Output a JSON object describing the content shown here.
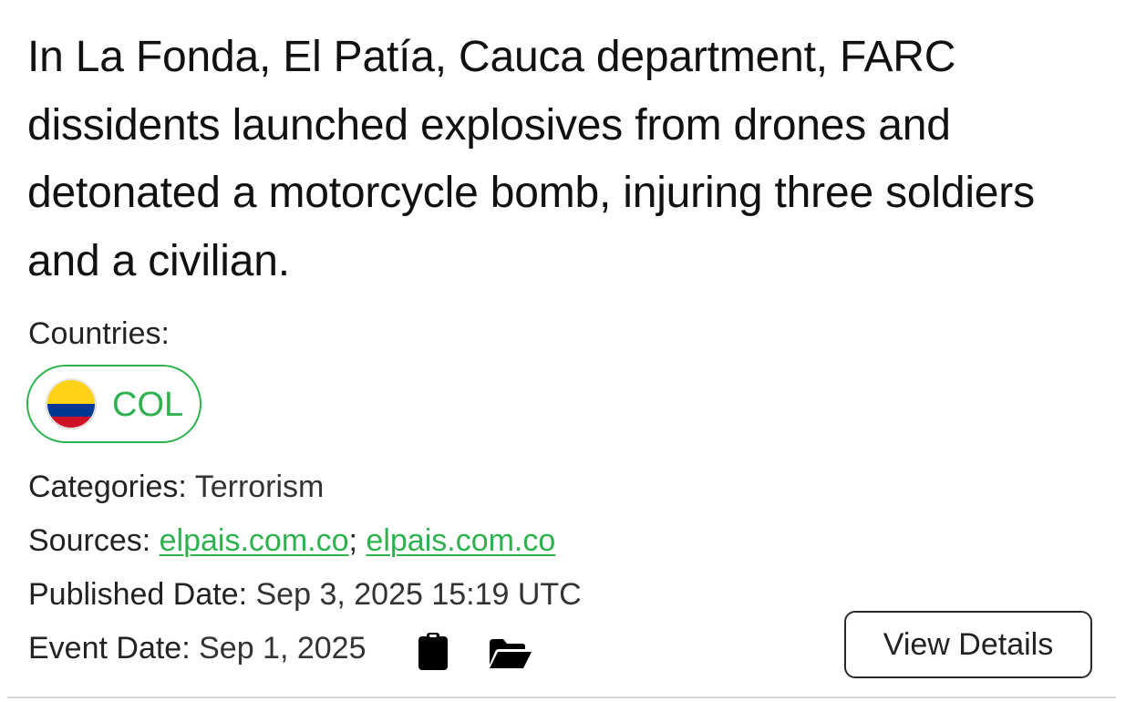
{
  "event": {
    "headline": "In La Fonda, El Patía, Cauca department, FARC dissidents launched explosives from drones and detonated a motorcycle bomb, injuring three soldiers and a civilian.",
    "countries_label": "Countries:",
    "countries": [
      {
        "code": "COL",
        "flag_icon": "colombia-flag-icon",
        "colors": [
          "#fcd116",
          "#003893",
          "#ce1126"
        ]
      }
    ],
    "categories_label": "Categories:",
    "categories_value": "Terrorism",
    "sources_label": "Sources:",
    "sources": [
      "elpais.com.co",
      "elpais.com.co"
    ],
    "sources_separator": ";",
    "published_label": "Published Date:",
    "published_value": "Sep 3, 2025 15:19 UTC",
    "event_date_label": "Event Date:",
    "event_date_value": "Sep 1, 2025",
    "icons": [
      "clipboard-icon",
      "folder-open-icon"
    ],
    "view_details_label": "View Details"
  },
  "colors": {
    "accent_green": "#2fb14f",
    "text": "#1c1c1c",
    "border": "#2a2a2a",
    "divider": "#d9d9d9"
  }
}
